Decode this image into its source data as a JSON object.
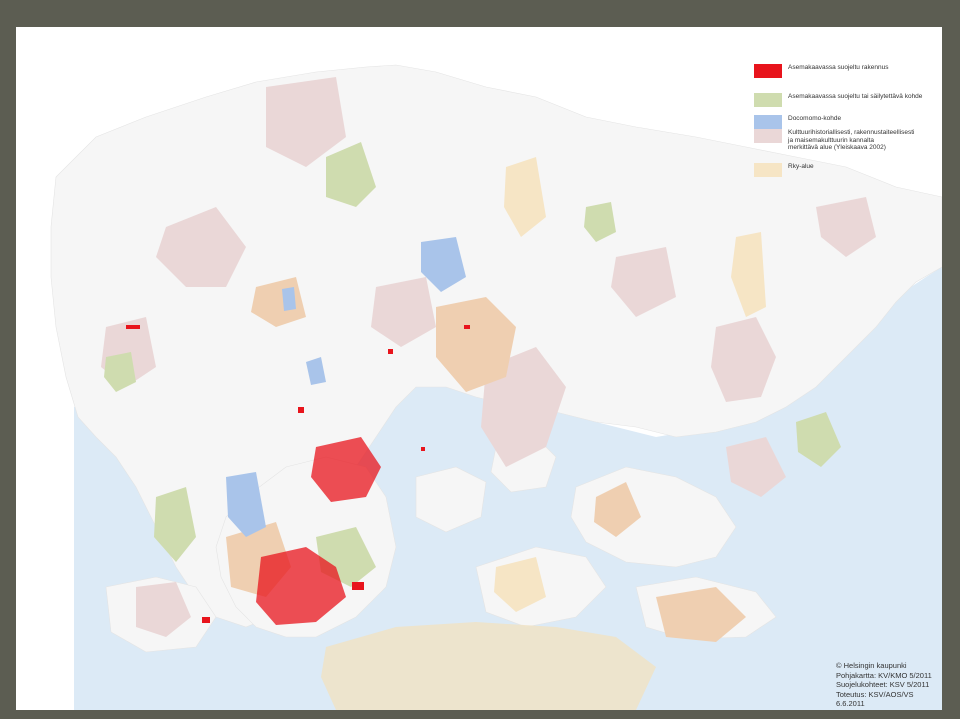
{
  "colors": {
    "frame": "#5c5d52",
    "paper": "#ffffff",
    "sea": "#dceaf6",
    "land": "#f6f6f6",
    "protected_building": "#e8141c",
    "protected_area": "#cfdcaf",
    "docomomo": "#a9c4ea",
    "cultural_env": "#ead7d7",
    "rky": "#f6e5c5",
    "orange_zone": "#efcfb1"
  },
  "legend": {
    "items": [
      {
        "label": "Asemakaavassa suojeltu rakennus",
        "color": "#e8141c"
      },
      {
        "label": "Asemakaavassa suojeltu tai säilytettävä kohde",
        "color": "#cfdcaf"
      },
      {
        "label": "Docomomo-kohde",
        "color": "#a9c4ea"
      },
      {
        "label": "Kulttuurihistoriallisesti, rakennustaiteellisesti\nja maisemakulttuurin kannalta\nmerkittävä alue (Yleiskaava 2002)",
        "color": "#ead7d7"
      },
      {
        "label": "Rky-alue",
        "color": "#f6e5c5"
      }
    ]
  },
  "credits": {
    "text": "© Helsingin kaupunki\nPohjakartta: KV/KMO 5/2011\nSuojelukohteet: KSV 5/2011\nToteutus: KSV/AOS/VS 6.6.2011"
  }
}
